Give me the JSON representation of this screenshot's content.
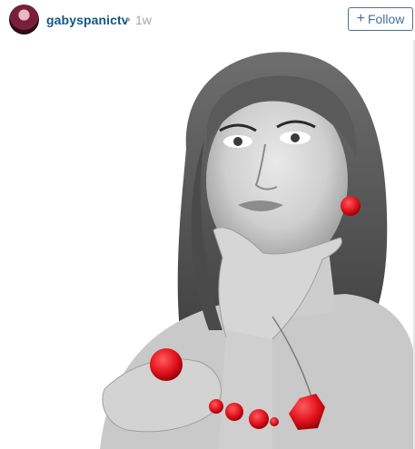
{
  "post": {
    "username": "gabyspanictv",
    "separator": "•",
    "time_ago": "1w",
    "follow_button": {
      "icon": "plus-icon",
      "label": "Follow"
    }
  },
  "photo": {
    "style": "black-and-white portrait with red jewelry",
    "accent_color": "#e0111b"
  },
  "colors": {
    "username": "#125688",
    "muted": "#a5a7aa",
    "follow_border": "#4e6f89",
    "follow_text": "#3f729b"
  }
}
